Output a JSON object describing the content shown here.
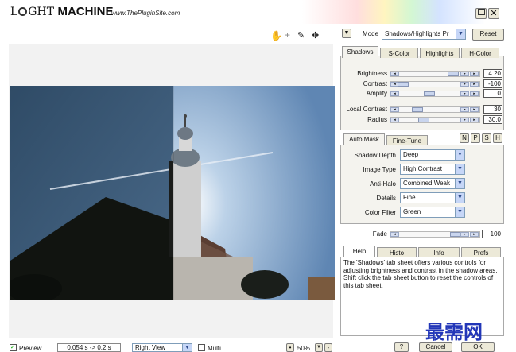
{
  "app": {
    "logo_a": "L",
    "logo_b": "GHT",
    "logo_c": "MACHINE",
    "url": "www.ThePluginSite.com"
  },
  "mode": {
    "label": "Mode",
    "value": "Shadows/Highlights Pr",
    "reset": "Reset"
  },
  "tabs_top": [
    "Shadows",
    "S-Color",
    "Highlights",
    "H-Color"
  ],
  "sliders": {
    "brightness": {
      "label": "Brightness",
      "value": "4.20",
      "level": 0.9
    },
    "contrast": {
      "label": "Contrast",
      "value": "-100",
      "level": 0.05
    },
    "amplify": {
      "label": "Amplify",
      "value": "0",
      "level": 0.5
    },
    "local_contrast": {
      "label": "Local Contrast",
      "value": "30",
      "level": 0.3
    },
    "radius": {
      "label": "Radius",
      "value": "30.0",
      "level": 0.4
    },
    "fade": {
      "label": "Fade",
      "value": "100",
      "level": 0.95
    }
  },
  "tabs_mid": [
    "Auto Mask",
    "Fine-Tune"
  ],
  "npsh": [
    "N",
    "P",
    "S",
    "H"
  ],
  "params": {
    "shadow_depth": {
      "label": "Shadow Depth",
      "value": "Deep"
    },
    "image_type": {
      "label": "Image Type",
      "value": "High Contrast"
    },
    "anti_halo": {
      "label": "Anti-Halo",
      "value": "Combined Weak"
    },
    "details": {
      "label": "Details",
      "value": "Fine"
    },
    "color_filter": {
      "label": "Color Filter",
      "value": "Green"
    }
  },
  "tabs_bottom": [
    "Help",
    "Histo",
    "Info",
    "Prefs"
  ],
  "help_text": "The 'Shadows' tab sheet offers various controls for adjusting brightness and contrast in the shadow areas. Shift click the tab sheet button to reset the controls of this tab sheet.",
  "bottom": {
    "preview": "Preview",
    "time": "0.054 s -> 0.2 s",
    "view": "Right View",
    "multi": "Multi",
    "zoom": "50%",
    "help_btn": "?",
    "cancel": "Cancel",
    "ok": "OK"
  },
  "watermark": "最需网",
  "colors": {
    "accent": "#0b2a8a",
    "panel": "#f4f3ee"
  }
}
